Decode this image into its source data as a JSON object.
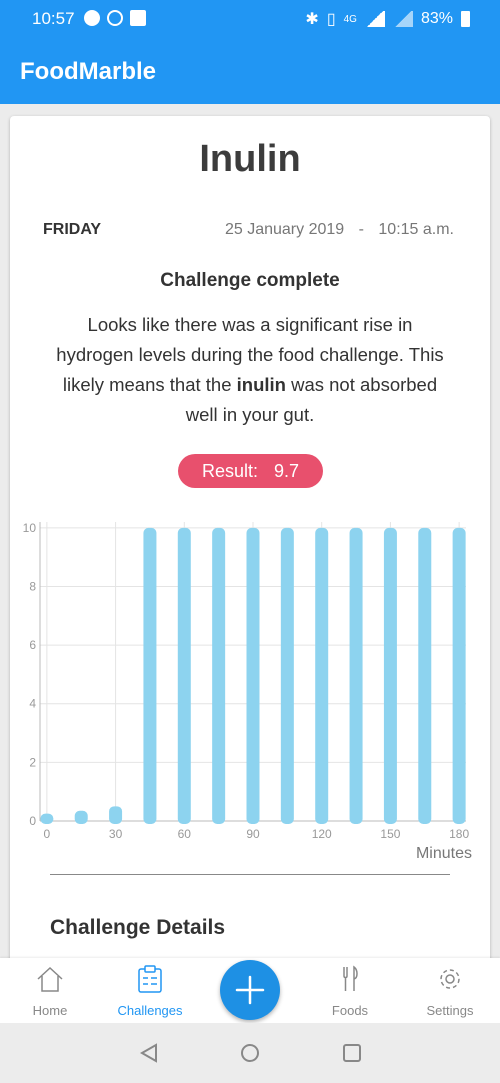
{
  "status_bar": {
    "time": "10:57",
    "battery": "83%",
    "network": "4G"
  },
  "app": {
    "title": "FoodMarble"
  },
  "challenge": {
    "name": "Inulin",
    "day": "FRIDAY",
    "date": "25 January 2019",
    "separator": "-",
    "time": "10:15 a.m.",
    "status": "Challenge complete",
    "description_part1": "Looks like there was a significant rise in hydrogen levels during the food challenge. This likely means that the ",
    "description_bold": "inulin",
    "description_part2": " was not absorbed well in your gut.",
    "result_label": "Result:",
    "result_value": "9.7"
  },
  "chart_data": {
    "type": "bar",
    "x": [
      0,
      15,
      30,
      45,
      60,
      75,
      90,
      105,
      120,
      135,
      150,
      165,
      180
    ],
    "values": [
      0.25,
      0.35,
      0.5,
      10,
      10,
      10,
      10,
      10,
      10,
      10,
      10,
      10,
      10
    ],
    "xticks": [
      "0",
      "30",
      "60",
      "90",
      "120",
      "150",
      "180"
    ],
    "yticks": [
      "0",
      "2",
      "4",
      "6",
      "8",
      "10"
    ],
    "xlabel": "Minutes",
    "ylabel": "",
    "ylim": [
      0,
      10.2
    ],
    "xlim": [
      -3,
      183
    ],
    "grid": true,
    "bar_color": "#8dd3ef"
  },
  "details": {
    "heading": "Challenge Details"
  },
  "bottom_nav": {
    "items": [
      {
        "label": "Home",
        "icon": "home-icon"
      },
      {
        "label": "Challenges",
        "icon": "clipboard-icon"
      },
      {
        "label": "Foods",
        "icon": "cutlery-icon"
      },
      {
        "label": "Settings",
        "icon": "gear-icon"
      }
    ],
    "fab_icon": "plus-icon"
  },
  "colors": {
    "primary": "#2196f3",
    "accent_result": "#e8506d",
    "bar": "#8dd3ef"
  }
}
